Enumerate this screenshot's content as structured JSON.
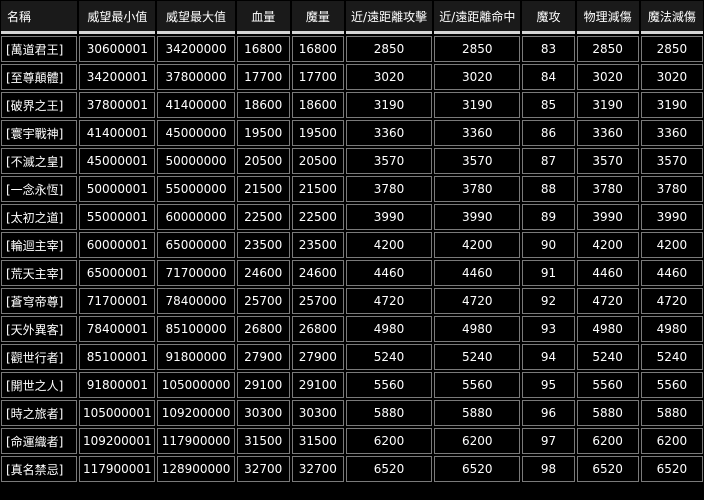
{
  "columns": [
    "名稱",
    "威望最小值",
    "威望最大值",
    "血量",
    "魔量",
    "近/遠距離攻擊",
    "近/遠距離命中",
    "魔攻",
    "物理減傷",
    "魔法減傷"
  ],
  "rows": [
    [
      "[萬道君王]",
      "30600001",
      "34200000",
      "16800",
      "16800",
      "2850",
      "2850",
      "83",
      "2850",
      "2850"
    ],
    [
      "[至尊顛體]",
      "34200001",
      "37800000",
      "17700",
      "17700",
      "3020",
      "3020",
      "84",
      "3020",
      "3020"
    ],
    [
      "[破界之王]",
      "37800001",
      "41400000",
      "18600",
      "18600",
      "3190",
      "3190",
      "85",
      "3190",
      "3190"
    ],
    [
      "[寰宇戰神]",
      "41400001",
      "45000000",
      "19500",
      "19500",
      "3360",
      "3360",
      "86",
      "3360",
      "3360"
    ],
    [
      "[不滅之皇]",
      "45000001",
      "50000000",
      "20500",
      "20500",
      "3570",
      "3570",
      "87",
      "3570",
      "3570"
    ],
    [
      "[一念永恆]",
      "50000001",
      "55000000",
      "21500",
      "21500",
      "3780",
      "3780",
      "88",
      "3780",
      "3780"
    ],
    [
      "[太初之道]",
      "55000001",
      "60000000",
      "22500",
      "22500",
      "3990",
      "3990",
      "89",
      "3990",
      "3990"
    ],
    [
      "[輪迴主宰]",
      "60000001",
      "65000000",
      "23500",
      "23500",
      "4200",
      "4200",
      "90",
      "4200",
      "4200"
    ],
    [
      "[荒天主宰]",
      "65000001",
      "71700000",
      "24600",
      "24600",
      "4460",
      "4460",
      "91",
      "4460",
      "4460"
    ],
    [
      "[蒼穹帝尊]",
      "71700001",
      "78400000",
      "25700",
      "25700",
      "4720",
      "4720",
      "92",
      "4720",
      "4720"
    ],
    [
      "[天外異客]",
      "78400001",
      "85100000",
      "26800",
      "26800",
      "4980",
      "4980",
      "93",
      "4980",
      "4980"
    ],
    [
      "[觀世行者]",
      "85100001",
      "91800000",
      "27900",
      "27900",
      "5240",
      "5240",
      "94",
      "5240",
      "5240"
    ],
    [
      "[開世之人]",
      "91800001",
      "105000000",
      "29100",
      "29100",
      "5560",
      "5560",
      "95",
      "5560",
      "5560"
    ],
    [
      "[時之旅者]",
      "105000001",
      "109200000",
      "30300",
      "30300",
      "5880",
      "5880",
      "96",
      "5880",
      "5880"
    ],
    [
      "[命運織者]",
      "109200001",
      "117900000",
      "31500",
      "31500",
      "6200",
      "6200",
      "97",
      "6200",
      "6200"
    ],
    [
      "[真名禁忌]",
      "117900001",
      "128900000",
      "32700",
      "32700",
      "6520",
      "6520",
      "98",
      "6520",
      "6520"
    ]
  ]
}
